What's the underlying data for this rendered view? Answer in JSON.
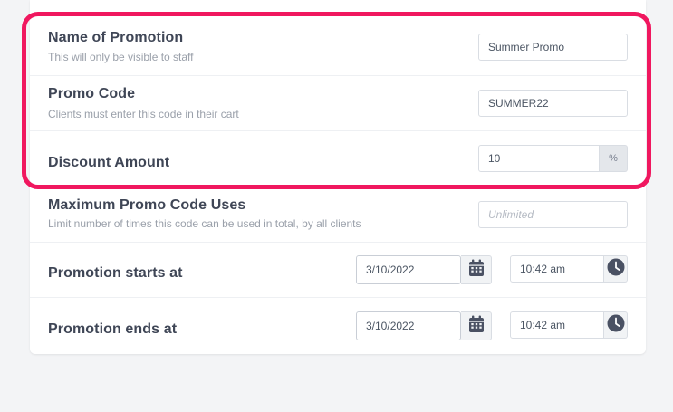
{
  "form": {
    "promo_name": {
      "label": "Name of Promotion",
      "hint": "This will only be visible to staff",
      "value": "Summer Promo"
    },
    "promo_code": {
      "label": "Promo Code",
      "hint": "Clients must enter this code in their cart",
      "value": "SUMMER22"
    },
    "discount": {
      "label": "Discount Amount",
      "value": "10",
      "unit": "%"
    },
    "max_uses": {
      "label": "Maximum Promo Code Uses",
      "hint": "Limit number of times this code can be used in total, by all clients",
      "placeholder": "Unlimited"
    },
    "starts": {
      "label": "Promotion starts at",
      "date": "3/10/2022",
      "time": "10:42 am",
      "date_icon": "calendar-icon",
      "time_icon": "clock-icon"
    },
    "ends": {
      "label": "Promotion ends at",
      "date": "3/10/2022",
      "time": "10:42 am",
      "date_icon": "calendar-icon",
      "time_icon": "clock-icon"
    }
  },
  "colors": {
    "highlight": "#f0175f",
    "icon": "#4a5163"
  }
}
